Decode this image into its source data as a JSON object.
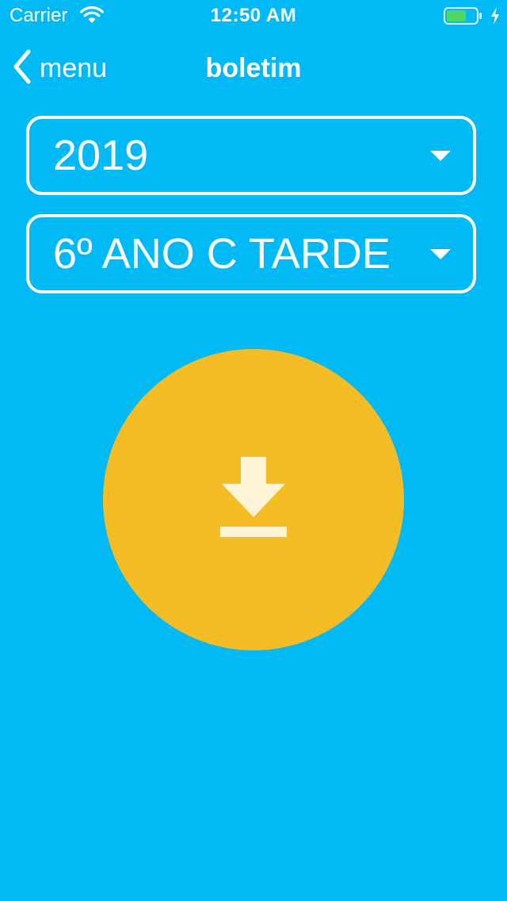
{
  "status_bar": {
    "carrier": "Carrier",
    "time": "12:50 AM",
    "battery_color": "#4CD964"
  },
  "nav": {
    "back_label": "menu",
    "title": "boletim"
  },
  "filters": {
    "year": "2019",
    "class_name": "6º ANO C TARDE"
  },
  "download": {
    "icon": "download-icon",
    "color": "#F4BD25"
  },
  "colors": {
    "background": "#00B9F5",
    "accent": "#F4BD25"
  }
}
